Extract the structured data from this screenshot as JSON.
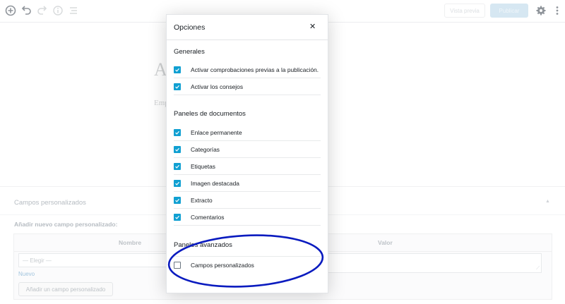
{
  "toolbar": {
    "preview_label": "Vista previa",
    "publish_label": "Publicar",
    "icons": [
      "add-block-icon",
      "undo-icon",
      "redo-icon",
      "info-icon",
      "list-view-icon",
      "gear-icon",
      "more-vertical-icon"
    ]
  },
  "editor": {
    "title_fragment": "A",
    "body_fragment": "Emp"
  },
  "custom_fields_box": {
    "title": "Campos personalizados",
    "toggle_glyph": "▲",
    "add_new_label": "Añadir nuevo campo personalizado:",
    "columns": [
      "Nombre",
      "Valor"
    ],
    "select_value": "— Elegir —",
    "new_link": "Nuevo",
    "add_button": "Añadir un campo personalizado"
  },
  "modal": {
    "title": "Opciones",
    "close_glyph": "✕",
    "sections": {
      "general": {
        "heading": "Generales",
        "items": [
          {
            "label": "Activar comprobaciones previas a la publicación.",
            "checked": true
          },
          {
            "label": "Activar los consejos",
            "checked": true
          }
        ]
      },
      "document": {
        "heading": "Paneles de documentos",
        "items": [
          {
            "label": "Enlace permanente",
            "checked": true
          },
          {
            "label": "Categorías",
            "checked": true
          },
          {
            "label": "Etiquetas",
            "checked": true
          },
          {
            "label": "Imagen destacada",
            "checked": true
          },
          {
            "label": "Extracto",
            "checked": true
          },
          {
            "label": "Comentarios",
            "checked": true
          }
        ]
      },
      "advanced": {
        "heading": "Paneles avanzados",
        "items": [
          {
            "label": "Campos personalizados",
            "checked": false
          }
        ]
      }
    }
  },
  "colors": {
    "checkbox_on": "#11a0d2",
    "annotation": "#0a1bbf",
    "publish_bg": "#c1dbec"
  }
}
